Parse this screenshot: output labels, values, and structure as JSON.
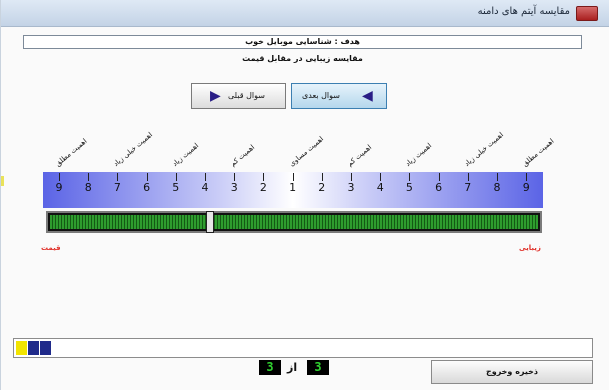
{
  "window": {
    "title": "مقایسه آیتم های دامنه"
  },
  "goal": {
    "text": "هدف : شناسایی موبایل خوب"
  },
  "comparison": {
    "text": "مقایسه زیبایی در مقابل قیمت"
  },
  "nav": {
    "prev_label": "سوال قبلی",
    "next_label": "سوال بعدی"
  },
  "scale": {
    "labels": [
      "اهمیت مطلق",
      "اهمیت خیلی زیاد",
      "اهمیت زیاد",
      "اهمیت کم",
      "اهمیت مساوی",
      "اهمیت کم",
      "اهمیت زیاد",
      "اهمیت خیلی زیاد",
      "اهمیت مطلق"
    ],
    "numbers": [
      "9",
      "8",
      "7",
      "6",
      "5",
      "4",
      "3",
      "2",
      "1",
      "2",
      "3",
      "4",
      "5",
      "6",
      "7",
      "8",
      "9"
    ],
    "selected": "4",
    "left_end_label": "قیمت",
    "right_end_label": "زیبایی"
  },
  "progress": {
    "completed": 3,
    "colors": [
      "#f2e400",
      "#1f2a8a",
      "#1f2a8a"
    ]
  },
  "counter": {
    "current": "3",
    "of_label": "از",
    "total": "3"
  },
  "footer": {
    "save_exit_label": "ذخیره وخروج"
  }
}
